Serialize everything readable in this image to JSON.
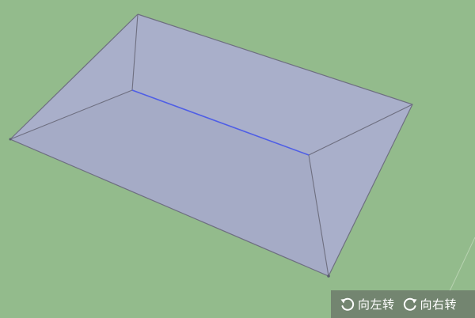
{
  "scene": {
    "background_color": "#93bb8c",
    "face_fill": "#a9afca",
    "edge_color": "#6e6f80",
    "selected_edge_color": "#4f5ee6"
  },
  "toolbar": {
    "rotate_left": {
      "label": "向左转",
      "icon": "rotate-left-icon"
    },
    "rotate_right": {
      "label": "向右转",
      "icon": "rotate-right-icon"
    }
  }
}
